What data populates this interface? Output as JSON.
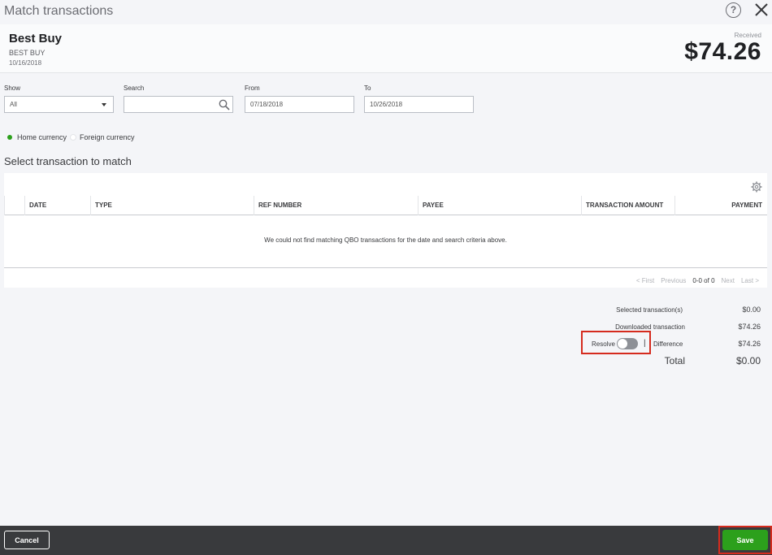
{
  "dialog": {
    "title": "Match transactions"
  },
  "bank_transaction": {
    "payee": "Best Buy",
    "bank_description": "BEST BUY",
    "date": "10/16/2018",
    "amount_label": "Received",
    "amount": "$74.26"
  },
  "filters": {
    "show_label": "Show",
    "show_value": "All",
    "search_label": "Search",
    "search_value": "",
    "from_label": "From",
    "from_value": "07/18/2018",
    "to_label": "To",
    "to_value": "10/26/2018"
  },
  "currency": {
    "home": "Home currency",
    "foreign": "Foreign currency",
    "selected": "home"
  },
  "section_title": "Select transaction to match",
  "table": {
    "columns": [
      "DATE",
      "TYPE",
      "REF NUMBER",
      "PAYEE",
      "TRANSACTION AMOUNT",
      "PAYMENT"
    ],
    "empty_message": "We could not find matching QBO transactions for the date and search criteria above.",
    "pagination": {
      "first": "< First",
      "previous": "Previous",
      "range": "0-0 of 0",
      "next": "Next",
      "last": "Last >"
    }
  },
  "totals": {
    "selected_label": "Selected transaction(s)",
    "selected_value": "$0.00",
    "downloaded_label": "Downloaded transaction",
    "downloaded_value": "$74.26",
    "resolve_label": "Resolve",
    "resolve_on": false,
    "pipe": "|",
    "difference_label": "Difference",
    "difference_value": "$74.26",
    "total_label": "Total",
    "total_value": "$0.00"
  },
  "footer": {
    "cancel_label": "Cancel",
    "save_label": "Save"
  },
  "colors": {
    "accent_green": "#2ca01c",
    "highlight_red": "#d52b1e",
    "footer_bg": "#393a3d"
  }
}
